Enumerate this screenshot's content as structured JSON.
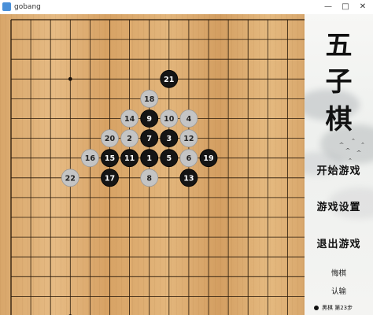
{
  "window": {
    "title": "gobang",
    "minimize_glyph": "—",
    "maximize_glyph": "□",
    "close_glyph": "✕"
  },
  "board": {
    "size": 19,
    "star_points": [
      [
        3,
        3
      ],
      [
        3,
        15
      ],
      [
        15,
        3
      ],
      [
        15,
        15
      ]
    ],
    "stones": [
      {
        "n": 1,
        "col": 7,
        "row": 7,
        "color": "black"
      },
      {
        "n": 2,
        "col": 6,
        "row": 6,
        "color": "white"
      },
      {
        "n": 3,
        "col": 8,
        "row": 6,
        "color": "black"
      },
      {
        "n": 4,
        "col": 9,
        "row": 5,
        "color": "white"
      },
      {
        "n": 5,
        "col": 8,
        "row": 7,
        "color": "black"
      },
      {
        "n": 6,
        "col": 9,
        "row": 7,
        "color": "white"
      },
      {
        "n": 7,
        "col": 7,
        "row": 6,
        "color": "black"
      },
      {
        "n": 8,
        "col": 7,
        "row": 8,
        "color": "white"
      },
      {
        "n": 9,
        "col": 7,
        "row": 5,
        "color": "black"
      },
      {
        "n": 10,
        "col": 8,
        "row": 5,
        "color": "white"
      },
      {
        "n": 11,
        "col": 6,
        "row": 7,
        "color": "black"
      },
      {
        "n": 12,
        "col": 9,
        "row": 6,
        "color": "white"
      },
      {
        "n": 13,
        "col": 9,
        "row": 8,
        "color": "black"
      },
      {
        "n": 14,
        "col": 6,
        "row": 5,
        "color": "white"
      },
      {
        "n": 15,
        "col": 5,
        "row": 7,
        "color": "black"
      },
      {
        "n": 16,
        "col": 4,
        "row": 7,
        "color": "white"
      },
      {
        "n": 17,
        "col": 5,
        "row": 8,
        "color": "black"
      },
      {
        "n": 18,
        "col": 7,
        "row": 4,
        "color": "white"
      },
      {
        "n": 19,
        "col": 10,
        "row": 7,
        "color": "black"
      },
      {
        "n": 20,
        "col": 5,
        "row": 6,
        "color": "white"
      },
      {
        "n": 21,
        "col": 8,
        "row": 3,
        "color": "black"
      },
      {
        "n": 22,
        "col": 3,
        "row": 8,
        "color": "white"
      }
    ]
  },
  "sidebar": {
    "title_chars": [
      "五",
      "子",
      "棋"
    ],
    "start_game": "开始游戏",
    "game_settings": "游戏设置",
    "exit_game": "退出游戏",
    "undo": "悔棋",
    "resign": "认输",
    "status_text": "黑棋 第23步"
  }
}
